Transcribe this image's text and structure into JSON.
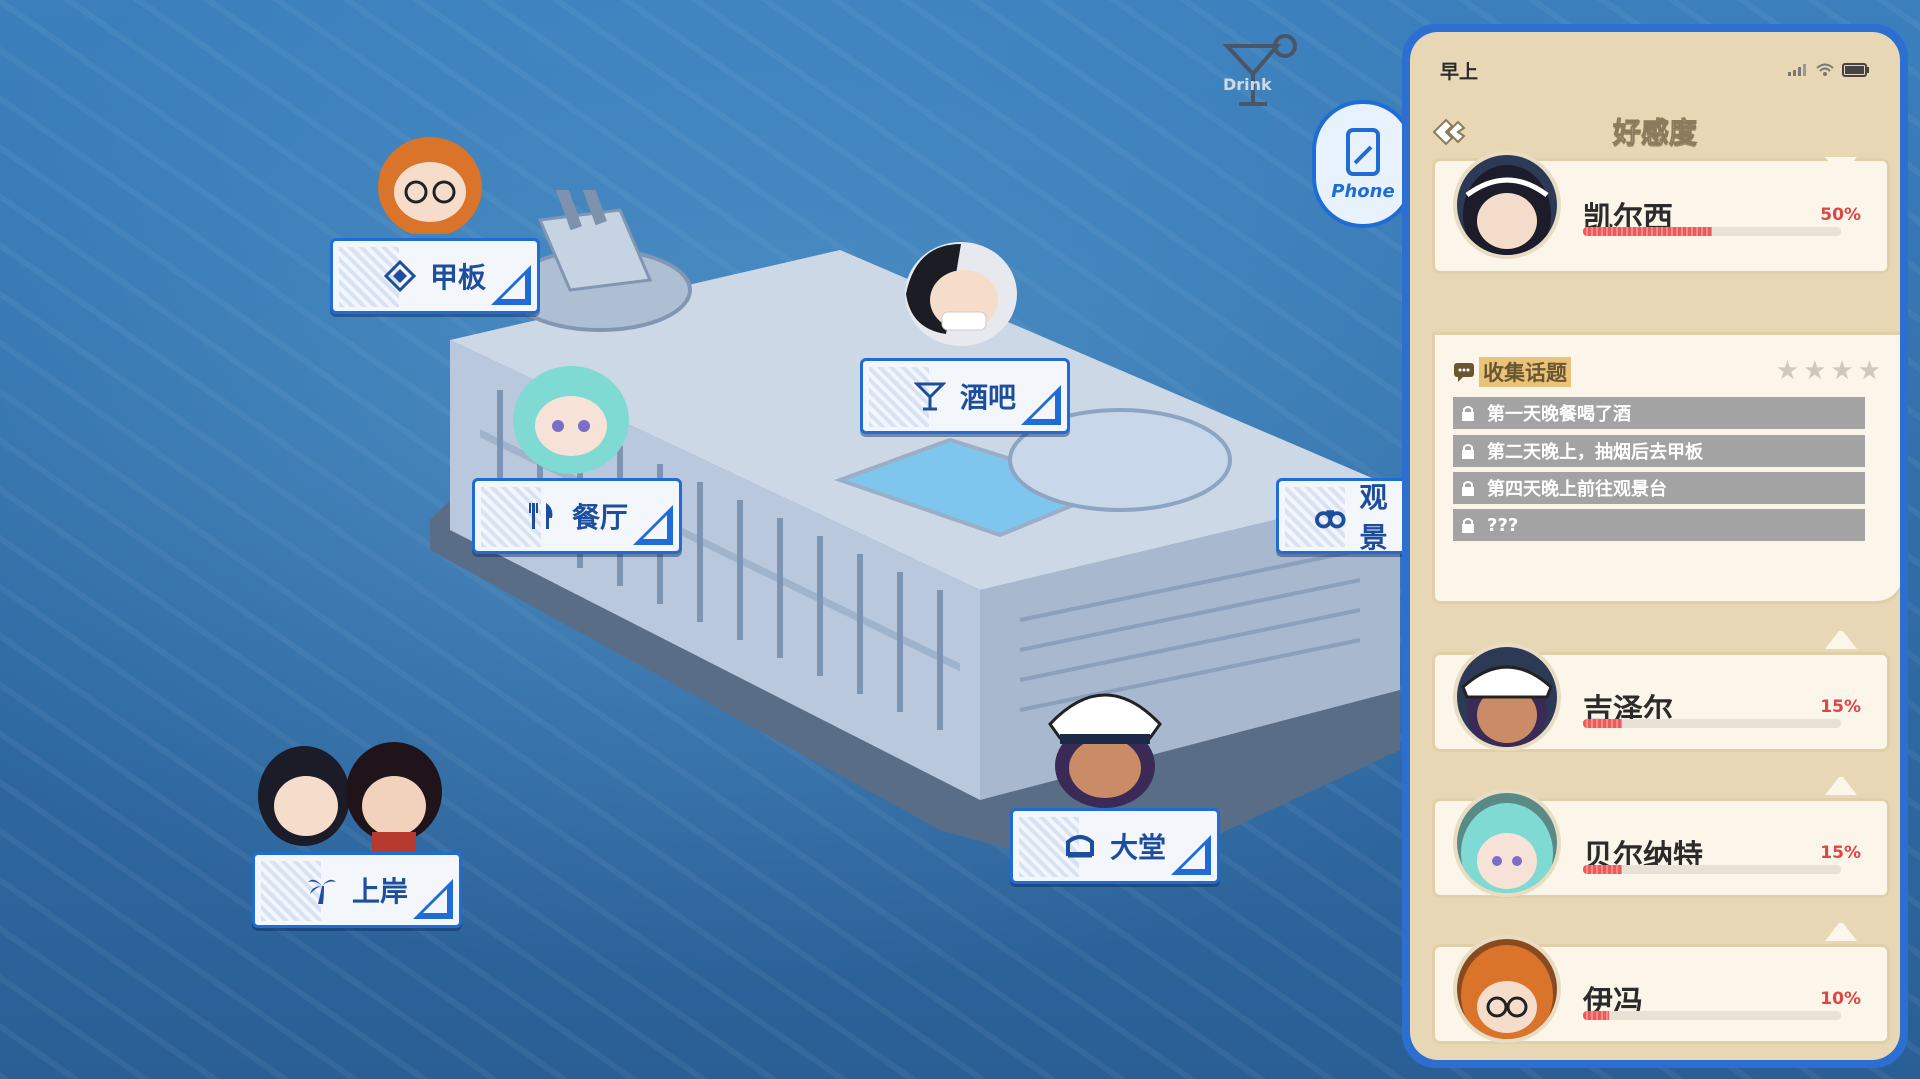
{
  "map": {
    "locations": [
      {
        "id": "deck",
        "label": "甲板",
        "icon": "deck-icon"
      },
      {
        "id": "bar",
        "label": "酒吧",
        "icon": "cocktail-icon"
      },
      {
        "id": "restaurant",
        "label": "餐厅",
        "icon": "fork-knife-icon"
      },
      {
        "id": "observation",
        "label": "观景",
        "icon": "binoculars-icon"
      },
      {
        "id": "lobby",
        "label": "大堂",
        "icon": "lobby-icon"
      },
      {
        "id": "shore",
        "label": "上岸",
        "icon": "palm-tree-icon"
      }
    ],
    "phone_button": "Phone",
    "drink_logo": "Drink"
  },
  "phone": {
    "time": "早上",
    "title": "好感度",
    "characters": [
      {
        "name": "凯尔西",
        "percent": "50%",
        "value": 0.5,
        "expanded": true
      },
      {
        "name": "吉泽尔",
        "percent": "15%",
        "value": 0.15,
        "expanded": false
      },
      {
        "name": "贝尔纳特",
        "percent": "15%",
        "value": 0.15,
        "expanded": false
      },
      {
        "name": "伊冯",
        "percent": "10%",
        "value": 0.1,
        "expanded": false
      }
    ],
    "topics": {
      "title": "收集话题",
      "stars_filled": 0,
      "stars_total": 4,
      "items": [
        "第一天晚餐喝了酒",
        "第二天晚上，抽烟后去甲板",
        "第四天晚上前往观景台",
        "???"
      ]
    }
  },
  "colors": {
    "accent": "#1f6cd6",
    "panel_bg": "#e7d7b4",
    "bar_fill": "#ee5a5a",
    "sea": "#2f6fa8"
  }
}
